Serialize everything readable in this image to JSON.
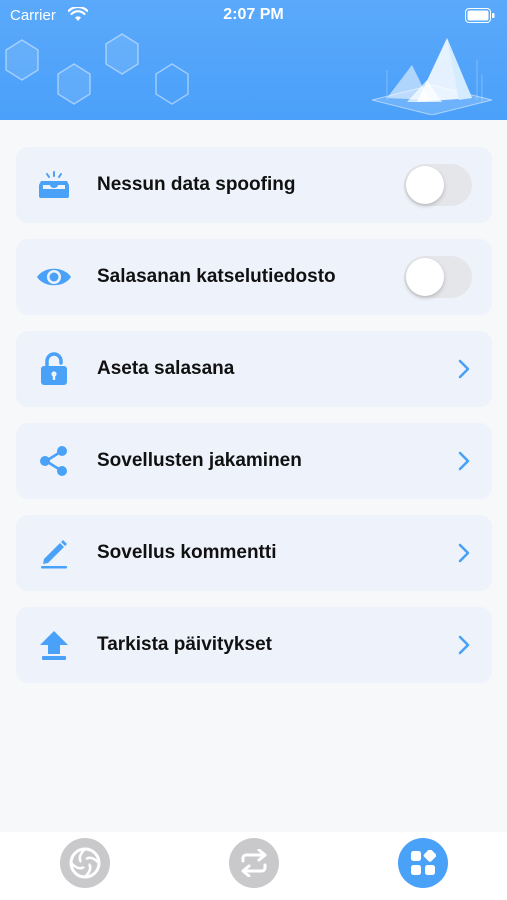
{
  "status_bar": {
    "carrier": "Carrier",
    "time": "2:07 PM"
  },
  "colors": {
    "accent": "#4aa1f8",
    "header": "#5aa9fb",
    "card_bg": "#eef3fb",
    "toggle_off": "#e5e6ea",
    "tab_inactive": "#c9c9cc"
  },
  "settings": {
    "items": [
      {
        "label": "Nessun data spoofing",
        "icon": "tray-icon",
        "control": "toggle",
        "state": "off"
      },
      {
        "label": "Salasanan katselutiedosto",
        "icon": "eye-icon",
        "control": "toggle",
        "state": "off"
      },
      {
        "label": "Aseta salasana",
        "icon": "lock-icon",
        "control": "chevron"
      },
      {
        "label": "Sovellusten jakaminen",
        "icon": "share-icon",
        "control": "chevron"
      },
      {
        "label": "Sovellus kommentti",
        "icon": "pencil-icon",
        "control": "chevron"
      },
      {
        "label": "Tarkista päivitykset",
        "icon": "upload-arrow-icon",
        "control": "chevron"
      }
    ]
  },
  "tab_bar": {
    "tabs": [
      {
        "icon": "aperture-icon",
        "active": false
      },
      {
        "icon": "switch-arrows-icon",
        "active": false
      },
      {
        "icon": "grid-icon",
        "active": true
      }
    ]
  }
}
